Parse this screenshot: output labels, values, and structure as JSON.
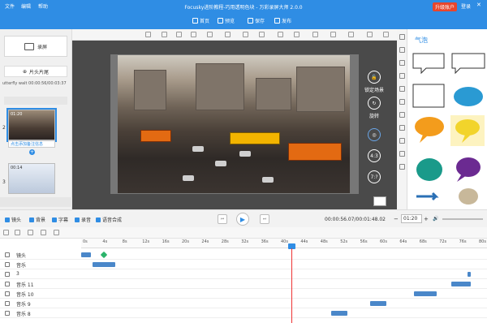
{
  "titlebar": {
    "title": "Focusky进阶教程-巧用透明色块 - 万彩录屏大师 2.0.0",
    "menu": [
      "文件",
      "编辑",
      "帮助"
    ],
    "buttons": [
      "首页",
      "预览",
      "保存",
      "发布"
    ],
    "upgrade": "升级账户",
    "login": "登录"
  },
  "left": {
    "record_label": "录屏",
    "clip_name": "utterfly walt",
    "time": "00:00:56/00:03:37",
    "scene1_time": "01:20",
    "scene1_num": "2",
    "scene1_note": "点击添加备注信息",
    "scene2_time": "00:14",
    "scene2_num": "3",
    "crop_label": "片头片尾"
  },
  "canvas": {
    "lock_label": "锁定场景",
    "rotate_label": "旋转",
    "ratio1": "4:3",
    "ratio2": "7:?"
  },
  "right": {
    "title": "气泡"
  },
  "controls": {
    "tabs": [
      "镜头",
      "背景",
      "字幕",
      "录音",
      "语音合成"
    ],
    "time": "00:00:56.07/00:01:48.02",
    "zoom": "01:20"
  },
  "timeline": {
    "ticks": [
      "0s",
      "4s",
      "8s",
      "12s",
      "16s",
      "20s",
      "24s",
      "28s",
      "32s",
      "36s",
      "40s",
      "44s",
      "48s",
      "52s",
      "56s",
      "60s",
      "64s",
      "68s",
      "72s",
      "76s",
      "80s"
    ],
    "tracks": [
      "镜头",
      "音乐",
      "3",
      "音乐 11",
      "音乐 10",
      "音乐 9",
      "音乐 8"
    ]
  }
}
